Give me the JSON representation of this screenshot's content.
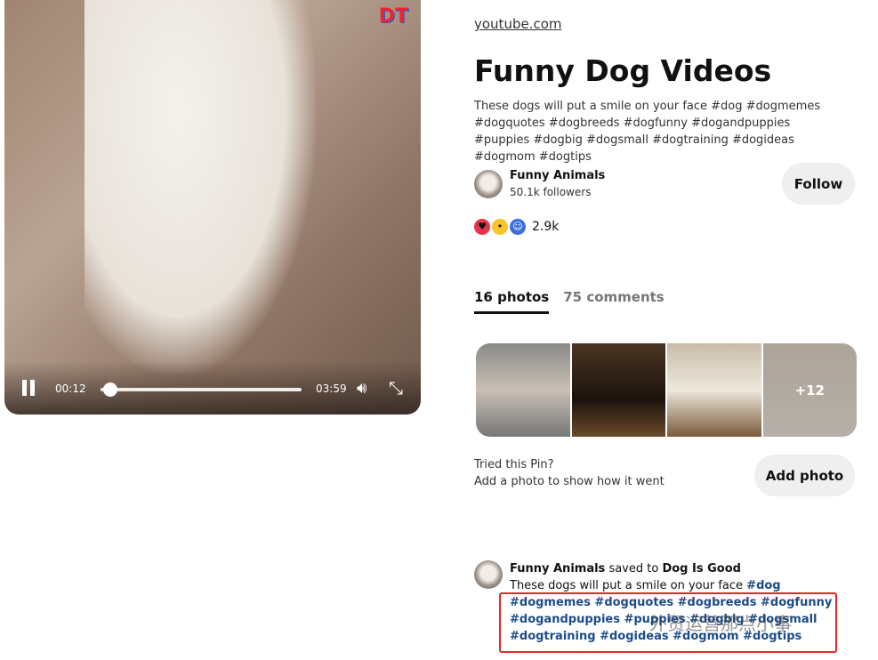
{
  "video": {
    "logo": "DT",
    "current_time": "00:12",
    "duration": "03:59",
    "progress_fraction": 0.05
  },
  "pin": {
    "source": "youtube.com",
    "title": "Funny Dog Videos",
    "description": "These dogs will put a smile on your face #dog #dogmemes #dogquotes #dogbreeds #dogfunny #dogandpuppies #puppies #dogbig #dogsmall #dogtraining #dogideas #dogmom #dogtips"
  },
  "author": {
    "name": "Funny Animals",
    "followers": "50.1k followers",
    "follow_label": "Follow"
  },
  "reactions": {
    "count": "2.9k",
    "icons": [
      "heart-eyes",
      "wow",
      "smile"
    ]
  },
  "tabs": [
    {
      "label": "16 photos"
    },
    {
      "label": "75 comments"
    }
  ],
  "photos": {
    "more": "+12"
  },
  "tried": {
    "line1": "Tried this Pin?",
    "line2": "Add a photo to show how it went",
    "button": "Add photo"
  },
  "comment": {
    "user": "Funny Animals",
    "saved_to": "saved to",
    "board": "Dog Is Good",
    "text": "These dogs will put a smile on your face",
    "tags": "#dog #dogmemes #dogquotes #dogbreeds #dogfunny #dogandpuppies #puppies #dogbig #dogsmall #dogtraining #dogideas #dogmom #dogtips"
  },
  "watermark": "外贸运营那点小事",
  "colors": {
    "highlight_box": "#e5262a",
    "tag": "#1b4c87"
  }
}
